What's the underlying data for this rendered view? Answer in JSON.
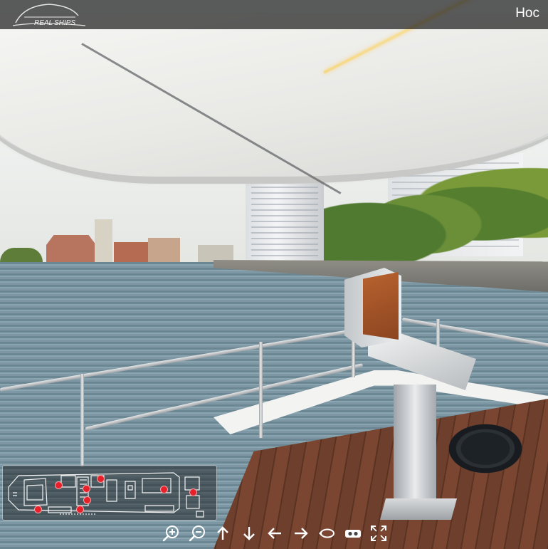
{
  "header": {
    "room_title": "Нос",
    "logo_icon": "realships-logo-icon"
  },
  "floorplan": {
    "markers": [
      {
        "name": "marker-1"
      },
      {
        "name": "marker-2"
      },
      {
        "name": "marker-3"
      },
      {
        "name": "marker-4"
      },
      {
        "name": "marker-5"
      },
      {
        "name": "marker-6"
      },
      {
        "name": "marker-7"
      },
      {
        "name": "marker-8"
      }
    ],
    "marker_color": "#e8202a"
  },
  "controls": [
    {
      "name": "zoom-in-button",
      "icon": "zoom-in-icon"
    },
    {
      "name": "zoom-out-button",
      "icon": "zoom-out-icon"
    },
    {
      "name": "move-up-button",
      "icon": "arrow-up-icon"
    },
    {
      "name": "move-down-button",
      "icon": "arrow-down-icon"
    },
    {
      "name": "move-left-button",
      "icon": "arrow-left-icon"
    },
    {
      "name": "move-right-button",
      "icon": "arrow-right-icon"
    },
    {
      "name": "autorotate-button",
      "icon": "rotate-icon"
    },
    {
      "name": "vr-button",
      "icon": "vr-headset-icon"
    },
    {
      "name": "fullscreen-button",
      "icon": "fullscreen-icon"
    }
  ]
}
